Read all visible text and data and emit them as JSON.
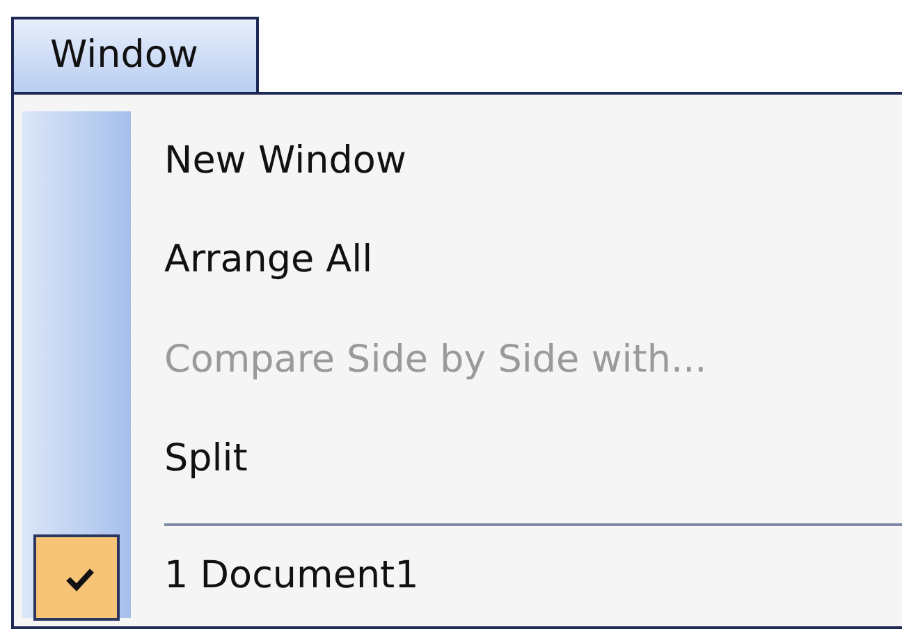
{
  "menu_title": "Window",
  "items": [
    {
      "kind": "command",
      "label": "New Window",
      "disabled": false,
      "checked": false
    },
    {
      "kind": "command",
      "label": "Arrange All",
      "disabled": false,
      "checked": false
    },
    {
      "kind": "command",
      "label": "Compare Side by Side with...",
      "disabled": true,
      "checked": false
    },
    {
      "kind": "command",
      "label": "Split",
      "disabled": false,
      "checked": false
    },
    {
      "kind": "separator"
    },
    {
      "kind": "command",
      "label": "1 Document1",
      "disabled": false,
      "checked": true
    }
  ]
}
